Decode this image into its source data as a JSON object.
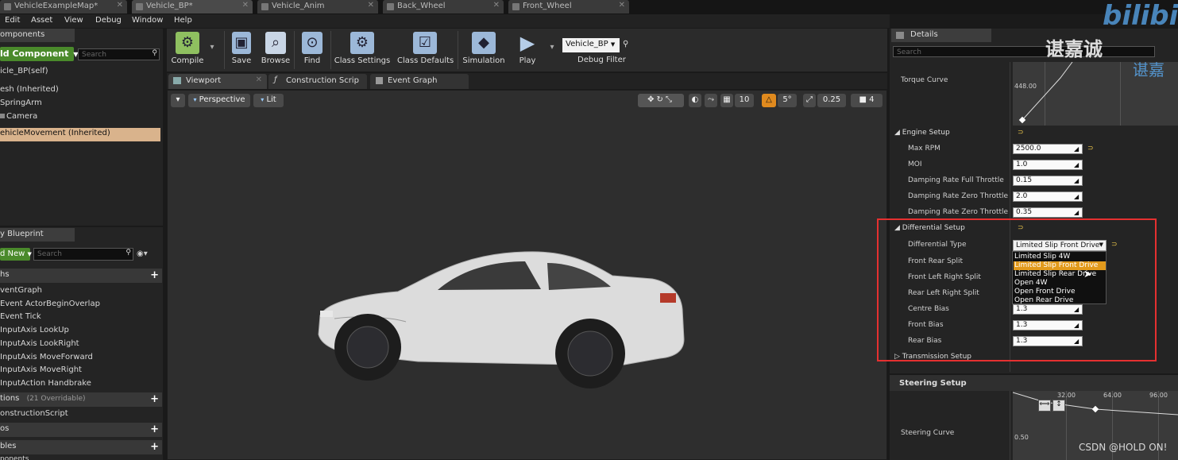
{
  "doc_tabs": [
    {
      "label": "VehicleExampleMap*"
    },
    {
      "label": "Vehicle_BP*"
    },
    {
      "label": "Vehicle_Anim"
    },
    {
      "label": "Back_Wheel"
    },
    {
      "label": "Front_Wheel"
    }
  ],
  "menu": [
    "Edit",
    "Asset",
    "View",
    "Debug",
    "Window",
    "Help"
  ],
  "components": {
    "tab": "omponents",
    "add_button": "ld Component",
    "search_placeholder": "Search",
    "self": "icle_BP(self)",
    "items": [
      "esh (Inherited)",
      "SpringArm",
      "Camera",
      "ehicleMovement (Inherited)"
    ]
  },
  "my_blueprint": {
    "tab": "y Blueprint",
    "add_new": "d New",
    "search_placeholder": "Search",
    "graphs_header": "hs",
    "graph_items": [
      "ventGraph",
      "Event ActorBeginOverlap",
      "Event Tick",
      "InputAxis LookUp",
      "InputAxis LookRight",
      "InputAxis MoveForward",
      "InputAxis MoveRight",
      "InputAction Handbrake"
    ],
    "functions_header": "tions",
    "functions_count": "(21 Overridable)",
    "construction_script": "onstructionScript",
    "macros_header": "os",
    "variables_header": "bles",
    "components_header": "ponents"
  },
  "toolbar": {
    "compile": "Compile",
    "save": "Save",
    "browse": "Browse",
    "find": "Find",
    "class_settings": "Class Settings",
    "class_defaults": "Class Defaults",
    "simulation": "Simulation",
    "play": "Play",
    "debug_object": "Vehicle_BP",
    "debug_filter": "Debug Filter"
  },
  "editor_tabs": {
    "viewport": "Viewport",
    "construction": "Construction Scrip",
    "event_graph": "Event Graph"
  },
  "viewport_bar": {
    "perspective": "Perspective",
    "lit": "Lit",
    "grid_snap": "10",
    "rot_snap": "5°",
    "scale_snap": "0.25",
    "cam_speed": "4"
  },
  "details": {
    "tab": "Details",
    "search_placeholder": "Search",
    "torque_curve_label": "Torque Curve",
    "torque_curve_value": "448.00",
    "engine_setup": "Engine Setup",
    "engine_rows": [
      {
        "label": "Max RPM",
        "value": "2500.0"
      },
      {
        "label": "MOI",
        "value": "1.0"
      },
      {
        "label": "Damping Rate Full Throttle",
        "value": "0.15"
      },
      {
        "label": "Damping Rate Zero Throttle Cl",
        "value": "2.0"
      },
      {
        "label": "Damping Rate Zero Throttle Cl",
        "value": "0.35"
      }
    ],
    "differential_setup": "Differential Setup",
    "differential_type_label": "Differential Type",
    "differential_type_value": "Limited Slip Front Drive",
    "dropdown_options": [
      "Limited Slip 4W",
      "Limited Slip Front Drive",
      "Limited Slip Rear Drive",
      "Open 4W",
      "Open Front Drive",
      "Open Rear Drive"
    ],
    "diff_rows": [
      {
        "label": "Front Rear Split",
        "value": ""
      },
      {
        "label": "Front Left Right Split",
        "value": ""
      },
      {
        "label": "Rear Left Right Split",
        "value": ""
      },
      {
        "label": "Centre Bias",
        "value": "1.3"
      },
      {
        "label": "Front Bias",
        "value": "1.3"
      },
      {
        "label": "Rear Bias",
        "value": "1.3"
      }
    ],
    "transmission_setup": "Transmission Setup",
    "steering_setup": "Steering Setup",
    "steering_curve_label": "Steering Curve",
    "steering_ticks": [
      "32.00",
      "64.00",
      "96.00"
    ],
    "steering_y": "0.50"
  },
  "watermark": {
    "cn_name": "谌嘉诚",
    "bili": "bilibili",
    "cn_small": "谌嘉",
    "csdn": "CSDN @HOLD ON!"
  },
  "colors": {
    "highlight_red": "#e53030",
    "selected_orange": "#e29a1c",
    "selected_row": "#d9b38c",
    "green": "#4a8a2b"
  }
}
